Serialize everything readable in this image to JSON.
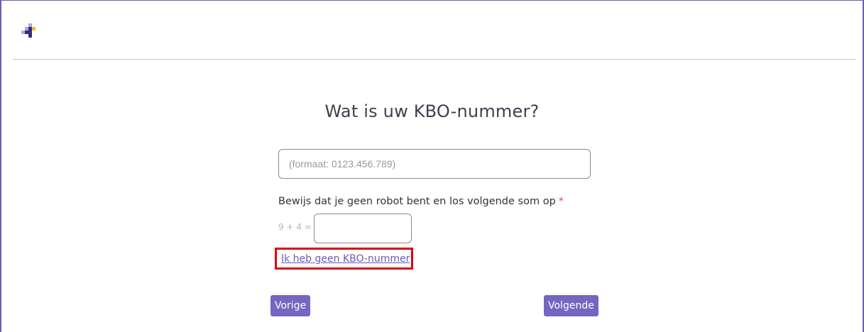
{
  "header": {
    "logo_icon": "brand-logo-icon",
    "colors": {
      "accent": "#7566c2",
      "logo_dark": "#3b2a7a",
      "logo_light": "#b3a8e0",
      "logo_yellow": "#e8c21a"
    }
  },
  "main": {
    "title": "Wat is uw KBO-nummer?",
    "kbo_field": {
      "placeholder": "(formaat: 0123.456.789)",
      "value": ""
    },
    "captcha": {
      "label": "Bewijs dat je geen robot bent en los volgende som op",
      "required_mark": "*",
      "question": "9 + 4 =",
      "value": ""
    },
    "no_kbo_link": "Ik heb geen KBO-nummer",
    "buttons": {
      "previous": "Vorige",
      "next": "Volgende"
    }
  }
}
